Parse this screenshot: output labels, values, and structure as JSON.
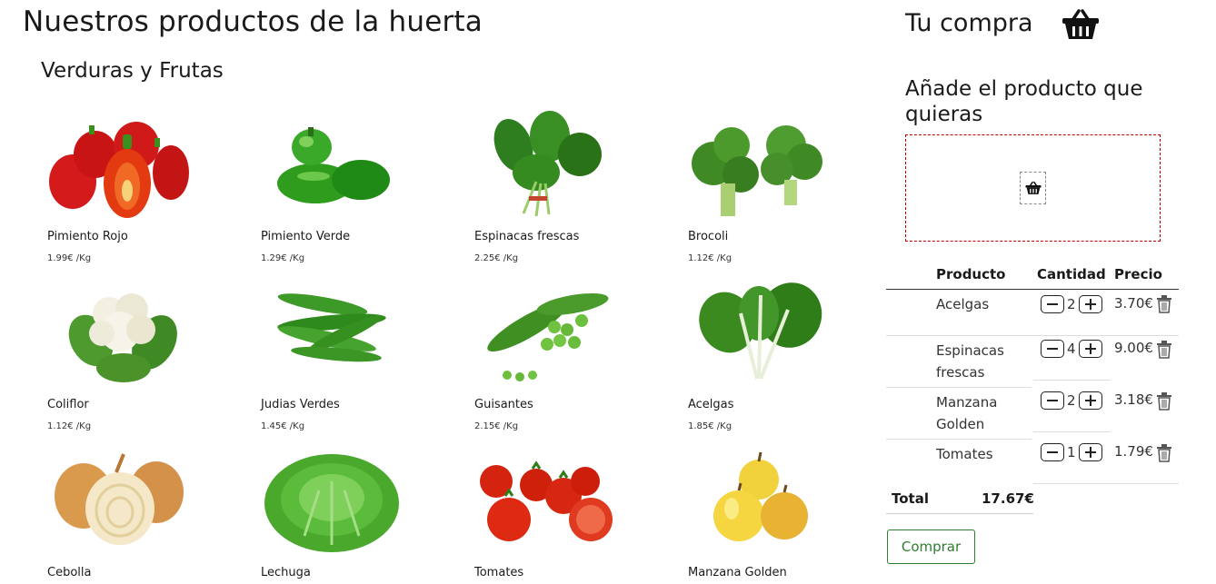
{
  "header": {
    "title": "Nuestros productos de la huerta"
  },
  "section": {
    "title": "Verduras y Frutas"
  },
  "products": [
    {
      "name": "Pimiento Rojo",
      "price": "1.99€ /Kg",
      "icon": "red-pepper-image"
    },
    {
      "name": "Pimiento Verde",
      "price": "1.29€ /Kg",
      "icon": "green-pepper-image"
    },
    {
      "name": "Espinacas frescas",
      "price": "2.25€ /Kg",
      "icon": "spinach-image"
    },
    {
      "name": "Brocoli",
      "price": "1.12€ /Kg",
      "icon": "broccoli-image"
    },
    {
      "name": "Coliflor",
      "price": "1.12€ /Kg",
      "icon": "cauliflower-image"
    },
    {
      "name": "Judias Verdes",
      "price": "1.45€ /Kg",
      "icon": "green-beans-image"
    },
    {
      "name": "Guisantes",
      "price": "2.15€ /Kg",
      "icon": "peas-image"
    },
    {
      "name": "Acelgas",
      "price": "1.85€ /Kg",
      "icon": "chard-image"
    },
    {
      "name": "Cebolla",
      "price": "",
      "icon": "onion-image"
    },
    {
      "name": "Lechuga",
      "price": "",
      "icon": "lettuce-image"
    },
    {
      "name": "Tomates",
      "price": "",
      "icon": "tomatoes-image"
    },
    {
      "name": "Manzana Golden",
      "price": "",
      "icon": "golden-apple-image"
    }
  ],
  "cart": {
    "title": "Tu compra",
    "basket_icon": "basket-icon",
    "drop_title": "Añade el producto que quieras",
    "columns": {
      "product": "Producto",
      "quantity": "Cantidad",
      "price": "Precio"
    },
    "items": [
      {
        "name": "Acelgas",
        "qty": "2",
        "price": "3.70€"
      },
      {
        "name": "Espinacas frescas",
        "qty": "4",
        "price": "9.00€"
      },
      {
        "name": "Manzana Golden",
        "qty": "2",
        "price": "3.18€"
      },
      {
        "name": "Tomates",
        "qty": "1",
        "price": "1.79€"
      }
    ],
    "total_label": "Total",
    "total_value": "17.67€",
    "buy_label": "Comprar"
  },
  "colors": {
    "accent": "#2e7d32",
    "drop_border": "#c00000"
  }
}
